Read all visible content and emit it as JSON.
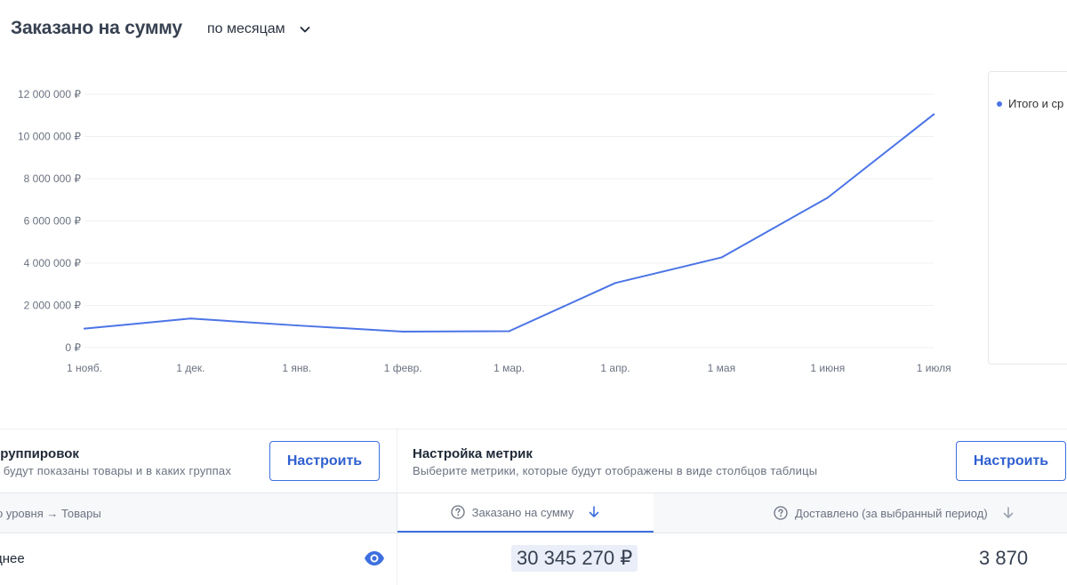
{
  "header": {
    "title": "Заказано на сумму",
    "period": {
      "selected": "по месяцам"
    }
  },
  "chart_data": {
    "type": "line",
    "x": [
      "1 нояб.",
      "1 дек.",
      "1 янв.",
      "1 февр.",
      "1 мар.",
      "1 апр.",
      "1 мая",
      "1 июня",
      "1 июля"
    ],
    "y_ticks": [
      "0 ₽",
      "2 000 000 ₽",
      "4 000 000 ₽",
      "6 000 000 ₽",
      "8 000 000 ₽",
      "10 000 000 ₽",
      "12 000 000 ₽"
    ],
    "ylim": [
      0,
      12000000
    ],
    "grid": true,
    "series": [
      {
        "name": "Итого и ср",
        "color": "#4b74e6",
        "values": [
          900000,
          1380000,
          1050000,
          760000,
          780000,
          3060000,
          4270000,
          7100000,
          11050000
        ]
      }
    ],
    "legend": "right"
  },
  "grouping": {
    "title": "группировок",
    "subtitle": "к будут показаны товары и в каких группах",
    "button_label": "Настроить"
  },
  "metrics": {
    "title": "Настройка метрик",
    "subtitle": "Выберите метрики, которые будут отображены в виде столбцов таблицы",
    "button_label": "Настроить"
  },
  "table": {
    "columns": {
      "path": "о уровня → Товары",
      "ordered": "Заказано на сумму",
      "delivered": "Доставлено (за выбранный период)"
    },
    "rows": [
      {
        "name": "днее",
        "ordered": "30 345 270 ₽",
        "delivered": "3 870"
      }
    ]
  },
  "colors": {
    "accent": "#3d6fe0",
    "line": "#4b74e6"
  }
}
